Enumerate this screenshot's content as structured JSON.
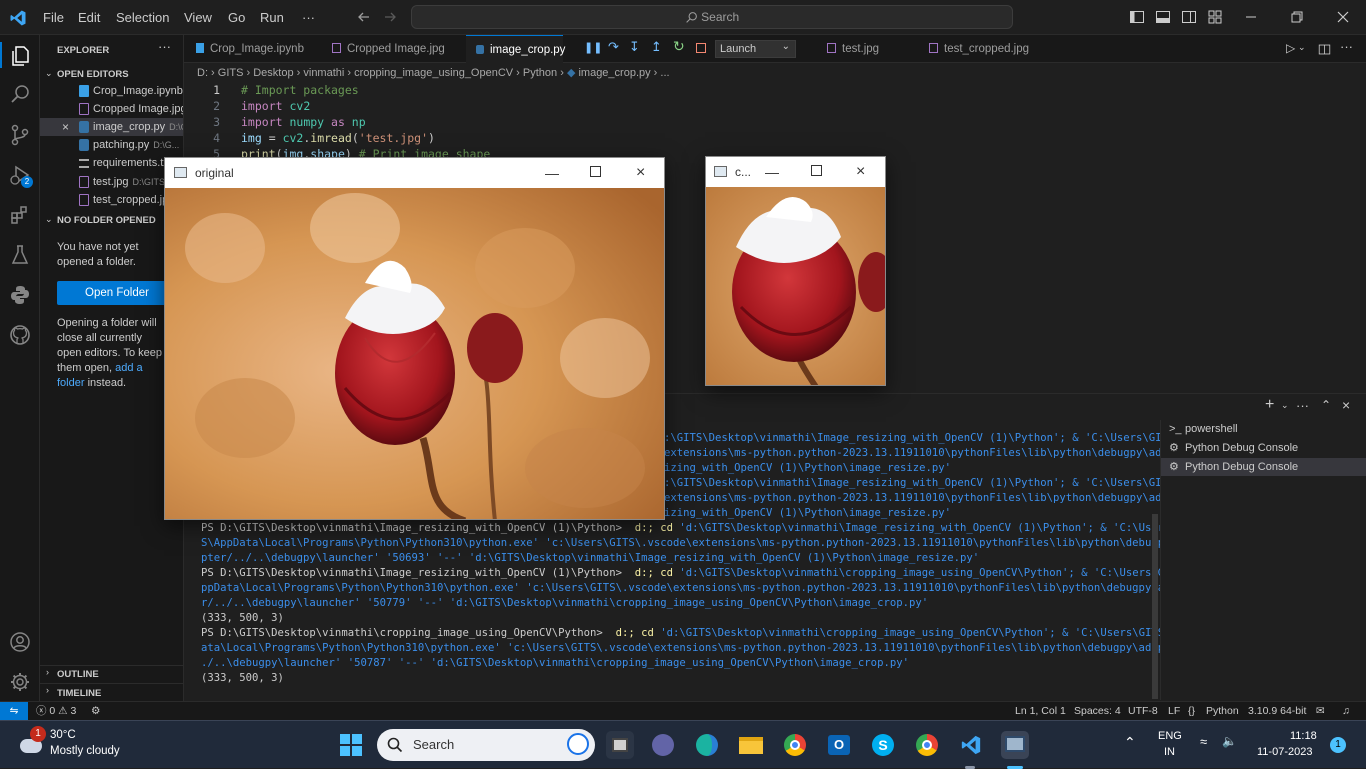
{
  "titlebar": {
    "menu": [
      "File",
      "Edit",
      "Selection",
      "View",
      "Go",
      "Run",
      "···"
    ],
    "search_placeholder": "Search"
  },
  "sidebar": {
    "title": "EXPLORER",
    "open_editors_label": "OPEN EDITORS",
    "open_editors": [
      {
        "name": "Crop_Image.ipynb",
        "dir": ""
      },
      {
        "name": "Cropped Image.jpg",
        "dir": ""
      },
      {
        "name": "image_crop.py",
        "dir": "D:\\G..."
      },
      {
        "name": "patching.py",
        "dir": "D:\\G..."
      },
      {
        "name": "requirements.txt",
        "dir": ""
      },
      {
        "name": "test.jpg",
        "dir": "D:\\GITS"
      },
      {
        "name": "test_cropped.jpg",
        "dir": ""
      }
    ],
    "no_folder_label": "NO FOLDER OPENED",
    "no_folder_text": "You have not yet opened a folder.",
    "open_folder_button": "Open Folder",
    "info_text_1": "Opening a folder will close all currently open editors. To keep them open, ",
    "info_link": "add a folder",
    "info_text_2": " instead.",
    "outline_label": "OUTLINE",
    "timeline_label": "TIMELINE",
    "debug_badge": "2"
  },
  "tabs": [
    {
      "label": "Crop_Image.ipynb",
      "active": false
    },
    {
      "label": "Cropped Image.jpg",
      "active": false
    },
    {
      "label": "image_crop.py",
      "active": true
    },
    {
      "label": "test.jpg",
      "active": false
    },
    {
      "label": "test_cropped.jpg",
      "active": false
    }
  ],
  "debug_toolbar": {
    "launch_label": "Launch"
  },
  "breadcrumb": [
    "D:",
    "GITS",
    "Desktop",
    "vinmathi",
    "cropping_image_using_OpenCV",
    "Python",
    "image_crop.py",
    "..."
  ],
  "code_lines": [
    "1",
    "2",
    "3",
    "4",
    "5"
  ],
  "code": {
    "l1": "# Import packages",
    "l2a": "import",
    "l2b": " cv2",
    "l3a": "import",
    "l3b": " numpy ",
    "l3c": "as",
    "l3d": " np",
    "l4a": "img",
    "l4b": " = ",
    "l4c": "cv2",
    "l4d": ".",
    "l4e": "imread",
    "l4f": "(",
    "l4g": "'test.jpg'",
    "l4h": ")",
    "l5a": "print",
    "l5b": "(",
    "l5c": "img",
    "l5d": ".",
    "l5e": "shape",
    "l5f": ") ",
    "l5g": "# Print image shape"
  },
  "windows": {
    "original_title": "original",
    "cropped_title": "c..."
  },
  "terminal": {
    "lines": [
      ":\\GITS\\Desktop\\vinmathi\\Image_resizing_with_OpenCV (1)\\Python'; & 'C:\\Users\\GIT",
      "extensions\\ms-python.python-2023.13.11911010\\pythonFiles\\lib\\python\\debugpy\\ada",
      "izing_with_OpenCV (1)\\Python\\image_resize.py'",
      ":\\GITS\\Desktop\\vinmathi\\Image_resizing_with_OpenCV (1)\\Python'; & 'C:\\Users\\GIT",
      "extensions\\ms-python.python-2023.13.11911010\\pythonFiles\\lib\\python\\debugpy\\ada",
      "izing_with_OpenCV (1)\\Python\\image_resize.py'"
    ],
    "full": [
      {
        "p": "PS D:\\GITS\\Desktop\\vinmathi\\Image_resizing_with_OpenCV (1)\\Python> ",
        "y": " d:; cd ",
        "c": "'d:\\GITS\\Desktop\\vinmathi\\Image_resizing_with_OpenCV (1)\\Python'; & 'C:\\Users\\GIT"
      },
      {
        "p": "",
        "y": "",
        "c": "S\\AppData\\Local\\Programs\\Python\\Python310\\python.exe' 'c:\\Users\\GITS\\.vscode\\extensions\\ms-python.python-2023.13.11911010\\pythonFiles\\lib\\python\\debugpy\\ada"
      },
      {
        "p": "",
        "y": "",
        "c": "pter/../..\\debugpy\\launcher' '50693' '--' 'd:\\GITS\\Desktop\\vinmathi\\Image_resizing_with_OpenCV (1)\\Python\\image_resize.py'"
      },
      {
        "p": "PS D:\\GITS\\Desktop\\vinmathi\\Image_resizing_with_OpenCV (1)\\Python> ",
        "y": " d:; cd ",
        "c": "'d:\\GITS\\Desktop\\vinmathi\\cropping_image_using_OpenCV\\Python'; & 'C:\\Users\\GITS\\A"
      },
      {
        "p": "",
        "y": "",
        "c": "ppData\\Local\\Programs\\Python\\Python310\\python.exe' 'c:\\Users\\GITS\\.vscode\\extensions\\ms-python.python-2023.13.11911010\\pythonFiles\\lib\\python\\debugpy\\adapte"
      },
      {
        "p": "",
        "y": "",
        "c": "r/../..\\debugpy\\launcher' '50779' '--' 'd:\\GITS\\Desktop\\vinmathi\\cropping_image_using_OpenCV\\Python\\image_crop.py'"
      },
      {
        "p": "(333, 500, 3)",
        "y": "",
        "c": ""
      },
      {
        "p": "PS D:\\GITS\\Desktop\\vinmathi\\cropping_image_using_OpenCV\\Python> ",
        "y": " d:; cd ",
        "c": "'d:\\GITS\\Desktop\\vinmathi\\cropping_image_using_OpenCV\\Python'; & 'C:\\Users\\GITS\\AppD"
      },
      {
        "p": "",
        "y": "",
        "c": "ata\\Local\\Programs\\Python\\Python310\\python.exe' 'c:\\Users\\GITS\\.vscode\\extensions\\ms-python.python-2023.13.11911010\\pythonFiles\\lib\\python\\debugpy\\adapter/."
      },
      {
        "p": "",
        "y": "",
        "c": "./..\\debugpy\\launcher' '50787' '--' 'd:\\GITS\\Desktop\\vinmathi\\cropping_image_using_OpenCV\\Python\\image_crop.py'"
      },
      {
        "p": "(333, 500, 3)",
        "y": "",
        "c": ""
      }
    ],
    "instances": [
      "powershell",
      "Python Debug Console",
      "Python Debug Console"
    ]
  },
  "statusbar": {
    "problems": "ⓧ 0 ⚠ 3",
    "position": "Ln 1, Col 1",
    "spaces": "Spaces: 4",
    "encoding": "UTF-8",
    "eol": "LF",
    "language": "Python",
    "interpreter": "3.10.9 64-bit"
  },
  "taskbar": {
    "weather_temp": "30°C",
    "weather_desc": "Mostly cloudy",
    "weather_badge": "1",
    "search_label": "Search",
    "lang_top": "ENG",
    "lang_bottom": "IN",
    "time": "11:18",
    "date": "11-07-2023",
    "notif_badge": "1"
  },
  "colors": {
    "accent": "#0078d4",
    "button": "#0078d4",
    "link": "#4daafc"
  }
}
